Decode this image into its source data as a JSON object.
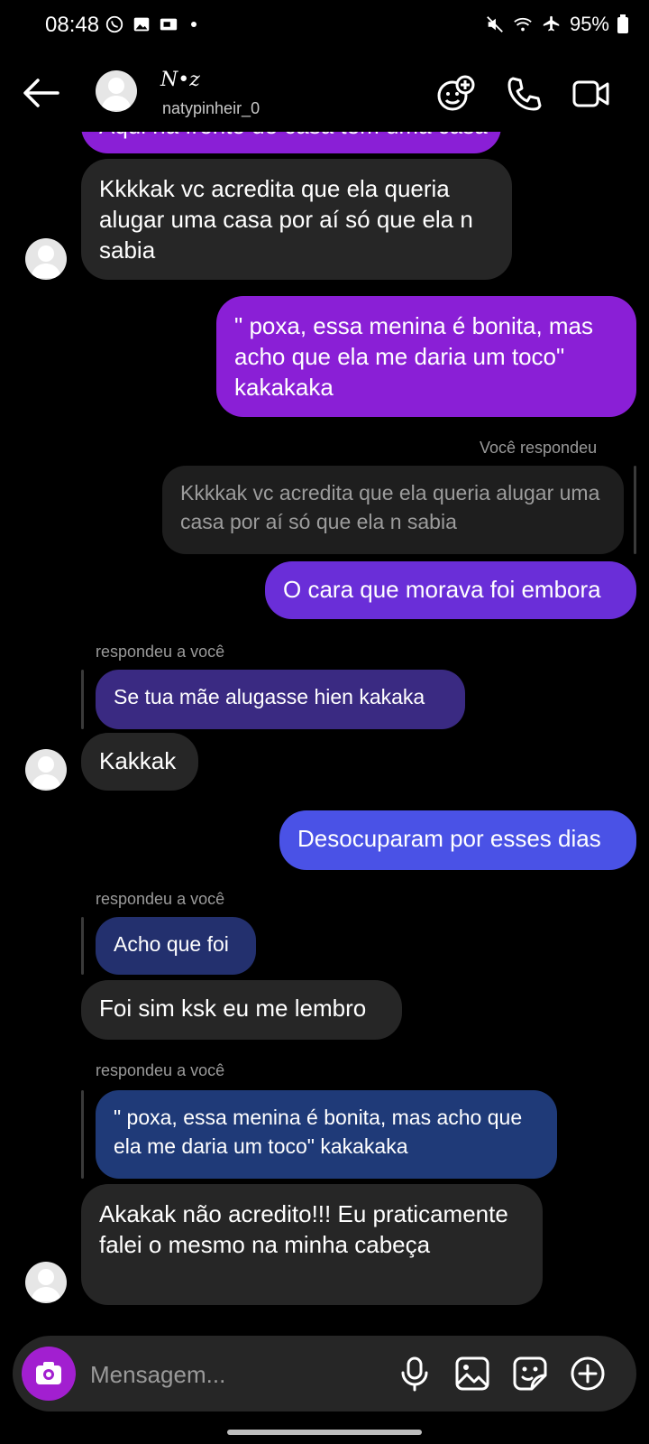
{
  "status": {
    "time": "08:48",
    "battery": "95%",
    "left_icons": [
      "whatsapp-icon",
      "gallery-icon",
      "tv-icon"
    ],
    "right_icons": [
      "mute-icon",
      "wifi-icon",
      "airplane-icon",
      "battery-icon"
    ]
  },
  "header": {
    "name_glyph": "N•z",
    "username": "natypinheir_0",
    "actions": [
      "effects-icon",
      "phone-icon",
      "video-icon"
    ]
  },
  "messages": {
    "m0_partial": "Aqui na frente de casa tem uma casa",
    "m1": "Kkkkak vc acredita que ela queria alugar uma casa por aí só que ela n sabia",
    "m2": "\" poxa, essa menina é bonita, mas acho que ela me daria um toco\" kakakaka",
    "m3_meta": "Você respondeu",
    "m3_quote": "Kkkkak vc acredita que ela queria alugar uma casa por aí só que ela n sabia",
    "m3": "O cara que morava foi embora",
    "m4_meta": "respondeu a você",
    "m4_quote": "Se tua mãe alugasse hien kakaka",
    "m4": "Kakkak",
    "m5": "Desocuparam por esses dias",
    "m6_meta": "respondeu a você",
    "m6_quote": "Acho que foi",
    "m6": "Foi sim ksk eu me lembro",
    "m7_meta": "respondeu a você",
    "m7_quote": "\" poxa, essa menina é bonita, mas acho que ela me daria um toco\" kakakaka",
    "m7": "Akakak não acredito!!! Eu praticamente falei o mesmo na minha cabeça"
  },
  "composer": {
    "placeholder": "Mensagem..."
  },
  "colors": {
    "incoming": "#262626",
    "out_purple": "#8a1fd6",
    "out_violet": "#6a2ed8",
    "out_blue": "#4a52e6",
    "quote_purple": "#3a2a82",
    "quote_navy": "#23306e",
    "quote_blue": "#1f3a78",
    "camera": "#a21fd0"
  }
}
